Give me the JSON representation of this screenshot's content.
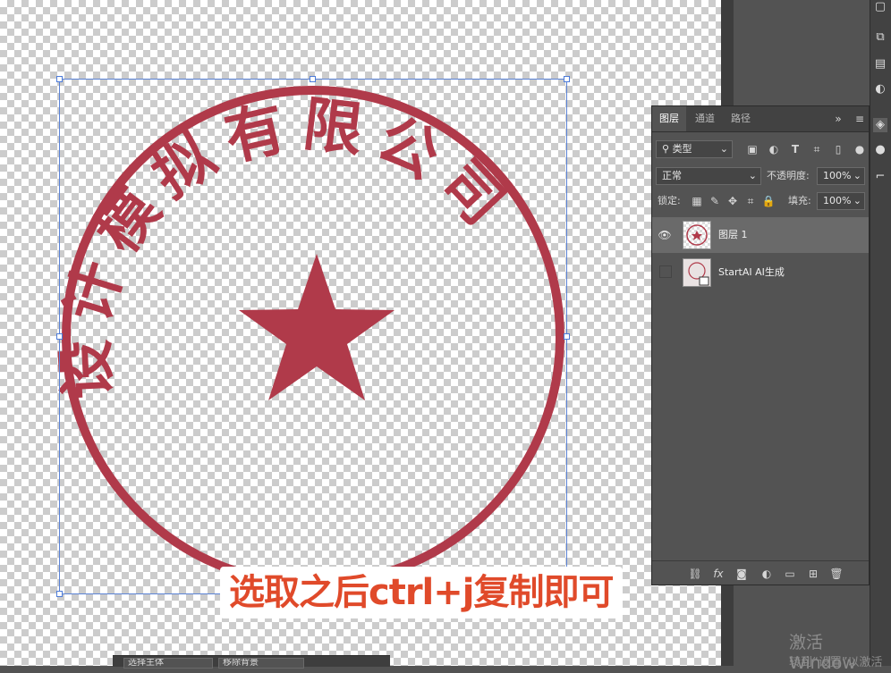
{
  "canvas": {
    "stamp_text": "设计模拟有限公司",
    "stamp_color": "#b03a4a"
  },
  "layers_panel": {
    "tabs": [
      "图层",
      "通道",
      "路径"
    ],
    "filter_kind": "类型",
    "blend_mode": "正常",
    "opacity_label": "不透明度:",
    "opacity_value": "100%",
    "lock_label": "锁定:",
    "fill_label": "填充:",
    "fill_value": "100%",
    "layers": [
      {
        "name": "图层 1",
        "visible": true,
        "selected": true
      },
      {
        "name": "StartAI AI生成",
        "visible": false,
        "selected": false
      }
    ]
  },
  "caption": "选取之后ctrl+j复制即可",
  "watermark": {
    "line1": "激活 Window",
    "line2": "转到“设置”以激活"
  },
  "taskbar": {
    "items": [
      "选择主体",
      "移除背景"
    ]
  },
  "colors": {
    "accent": "#e04a2a",
    "selection": "#5b83d6",
    "panel_bg": "#535353"
  }
}
